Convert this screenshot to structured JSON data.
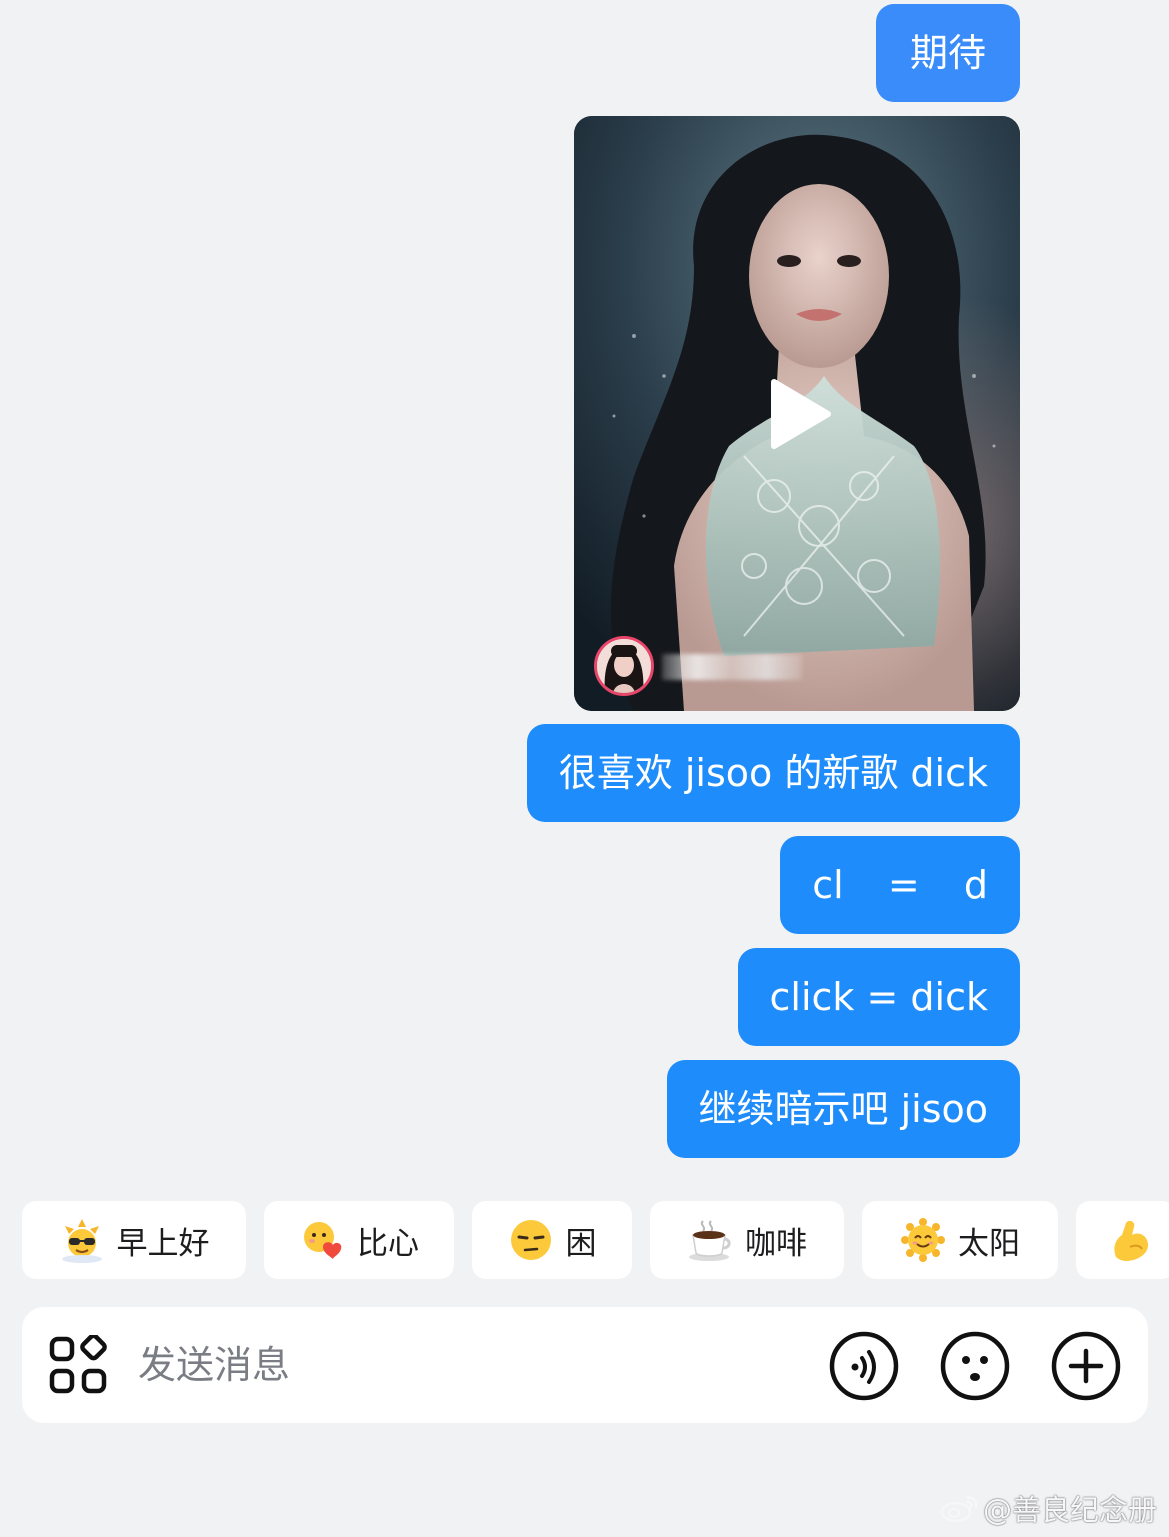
{
  "messages": [
    {
      "text": "期待"
    },
    {
      "text": "很喜欢 jisoo 的新歌 dick"
    },
    {
      "text": "cl  =  d"
    },
    {
      "text": "click = dick"
    },
    {
      "text": "继续暗示吧 jisoo"
    }
  ],
  "video": {
    "play_icon": "play-icon",
    "author_avatar": "avatar"
  },
  "quick_replies": [
    {
      "label": "早上好",
      "icon": "sun-sunglasses-icon"
    },
    {
      "label": "比心",
      "icon": "finger-heart-icon"
    },
    {
      "label": "困",
      "icon": "sleepy-face-icon"
    },
    {
      "label": "咖啡",
      "icon": "coffee-icon"
    },
    {
      "label": "太阳",
      "icon": "smiling-sun-icon"
    },
    {
      "label": "",
      "icon": "flexed-arm-icon"
    }
  ],
  "input": {
    "placeholder": "发送消息"
  },
  "watermark": {
    "text": "@善良纪念册"
  },
  "colors": {
    "bubble": "#1f8cfb",
    "background": "#f1f2f4"
  }
}
